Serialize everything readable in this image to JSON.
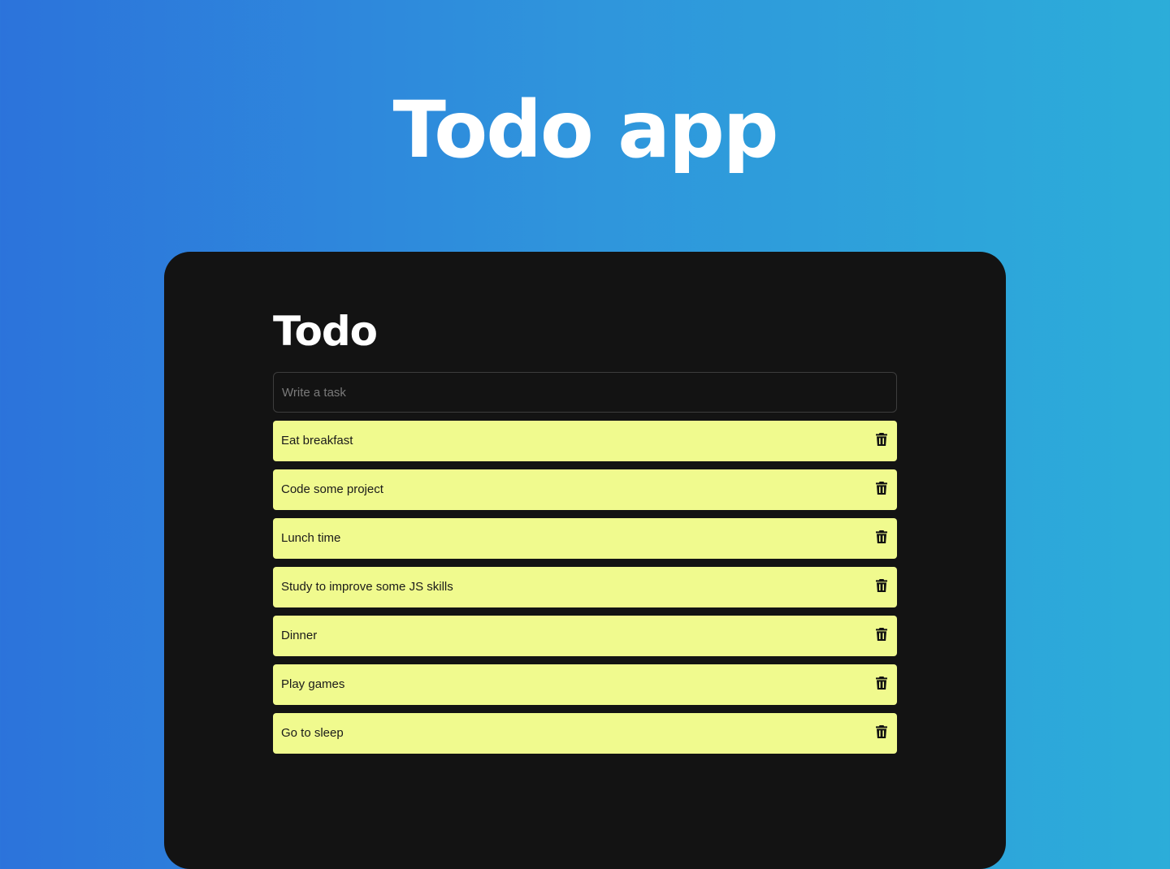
{
  "header": {
    "title": "Todo app"
  },
  "panel": {
    "title": "Todo",
    "input": {
      "placeholder": "Write a task",
      "value": ""
    },
    "tasks": [
      {
        "label": "Eat breakfast"
      },
      {
        "label": "Code some project"
      },
      {
        "label": "Lunch time"
      },
      {
        "label": "Study to improve some JS skills"
      },
      {
        "label": "Dinner"
      },
      {
        "label": "Play games"
      },
      {
        "label": "Go to sleep"
      }
    ],
    "task_action_icon": "trash-icon"
  },
  "colors": {
    "background_gradient_start": "#2c73db",
    "background_gradient_end": "#2cadd9",
    "panel_background": "#131313",
    "task_background": "#f0fa8e",
    "text_light": "#ffffff",
    "text_dark": "#1a1a1a"
  }
}
